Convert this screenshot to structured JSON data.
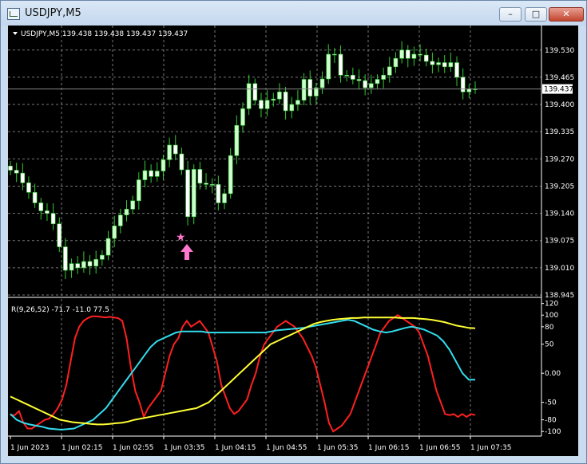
{
  "window": {
    "title": "USDJPY,M5",
    "minimize_glyph": "–",
    "maximize_glyph": "□",
    "close_glyph": "✕"
  },
  "chart": {
    "header": "USDJPY,M5  139.438 139.438 139.437 139.437",
    "current_price": "139.437",
    "price_axis_labels": [
      "139.530",
      "139.465",
      "139.400",
      "139.335",
      "139.270",
      "139.205",
      "139.140",
      "139.075",
      "139.010",
      "138.945"
    ],
    "time_axis_labels": [
      "1 Jun 2023",
      "1 Jun 02:15",
      "1 Jun 02:55",
      "1 Jun 03:35",
      "1 Jun 04:15",
      "1 Jun 04:55",
      "1 Jun 05:35",
      "1 Jun 06:15",
      "1 Jun 06:55",
      "1 Jun 07:35"
    ],
    "star_marker": "★",
    "arrow_marker": "up-arrow",
    "colors": {
      "background": "#000000",
      "bull": "#ccffcc",
      "bear": "#ffffff",
      "wick": "#33cc33",
      "grid": "#777777",
      "axis_text": "#ffffff",
      "marker": "#ff77cc"
    }
  },
  "indicator": {
    "label": "R(9,26,52) -71.7 -11.0 77.5",
    "axis_labels": [
      "120",
      "100",
      "80",
      "50",
      "0.00",
      "-50",
      "-80",
      "-100"
    ],
    "colors": {
      "fast": "#ff2020",
      "mid": "#33ddee",
      "slow": "#ffff33"
    }
  },
  "chart_data": [
    {
      "type": "candlestick",
      "title": "USDJPY,M5",
      "ylim": [
        138.945,
        139.56
      ],
      "x": [
        "1 Jun 2023",
        "1 Jun 02:15",
        "1 Jun 02:55",
        "1 Jun 03:35",
        "1 Jun 04:15",
        "1 Jun 04:55",
        "1 Jun 05:35",
        "1 Jun 06:15",
        "1 Jun 06:55",
        "1 Jun 07:35"
      ],
      "close": [
        139.243,
        139.236,
        139.213,
        139.19,
        139.165,
        139.146,
        139.14,
        139.115,
        139.06,
        139.004,
        139.02,
        139.01,
        139.025,
        139.014,
        139.03,
        139.04,
        139.08,
        139.11,
        139.136,
        139.15,
        139.17,
        139.22,
        139.242,
        139.228,
        139.241,
        139.268,
        139.303,
        139.282,
        139.244,
        139.132,
        139.245,
        139.212,
        139.209,
        139.209,
        139.165,
        139.187,
        139.278,
        139.35,
        139.39,
        139.45,
        139.41,
        139.39,
        139.41,
        139.413,
        139.43,
        139.385,
        139.4,
        139.41,
        139.46,
        139.42,
        139.44,
        139.461,
        139.52,
        139.52,
        139.47,
        139.47,
        139.46,
        139.457,
        139.44,
        139.45,
        139.46,
        139.47,
        139.49,
        139.51,
        139.53,
        139.51,
        139.52,
        139.518,
        139.503,
        139.495,
        139.5,
        139.49,
        139.5,
        139.465,
        139.43,
        139.437,
        139.437
      ]
    },
    {
      "type": "line",
      "title": "R(9,26,52) -71.7 -11.0 77.5",
      "ylim": [
        -108,
        125
      ],
      "series": [
        {
          "name": "R(9)",
          "values": [
            -72,
            -72,
            -65,
            -85,
            -95,
            -95,
            -90,
            -85,
            -80,
            -78,
            -70,
            -60,
            -45,
            -20,
            20,
            60,
            80,
            90,
            95,
            98,
            98,
            97,
            96,
            97,
            96,
            95,
            90,
            60,
            10,
            -30,
            -50,
            -75,
            -60,
            -50,
            -40,
            -30,
            0,
            30,
            50,
            60,
            80,
            90,
            80,
            85,
            90,
            80,
            70,
            45,
            20,
            -20,
            -40,
            -60,
            -70,
            -65,
            -55,
            -45,
            -20,
            0,
            30,
            50,
            60,
            70,
            80,
            85,
            90,
            85,
            80,
            70,
            60,
            45,
            30,
            10,
            -20,
            -50,
            -85,
            -100,
            -95,
            -90,
            -80,
            -70,
            -50,
            -30,
            -10,
            10,
            30,
            50,
            70,
            80,
            90,
            95,
            100,
            95,
            90,
            85,
            80,
            70,
            50,
            30,
            0,
            -30,
            -50,
            -70,
            -72,
            -70,
            -75,
            -70,
            -75,
            -70,
            -72
          ]
        },
        {
          "name": "R(26)",
          "values": [
            -70,
            -80,
            -85,
            -88,
            -90,
            -92,
            -95,
            -96,
            -97,
            -96,
            -95,
            -90,
            -85,
            -80,
            -70,
            -60,
            -45,
            -30,
            -15,
            0,
            15,
            30,
            45,
            55,
            60,
            65,
            70,
            72,
            72,
            72,
            72,
            70,
            70,
            70,
            70,
            70,
            70,
            70,
            70,
            70,
            70,
            72,
            74,
            75,
            76,
            77,
            78,
            80,
            82,
            84,
            86,
            88,
            90,
            92,
            90,
            85,
            80,
            75,
            72,
            70,
            72,
            75,
            78,
            80,
            78,
            75,
            70,
            65,
            55,
            40,
            20,
            0,
            -11,
            -11
          ]
        },
        {
          "name": "R(52)",
          "values": [
            -40,
            -45,
            -50,
            -55,
            -60,
            -65,
            -70,
            -75,
            -80,
            -82,
            -84,
            -85,
            -86,
            -87,
            -88,
            -88,
            -87,
            -86,
            -85,
            -83,
            -80,
            -78,
            -76,
            -74,
            -72,
            -70,
            -68,
            -66,
            -64,
            -62,
            -60,
            -55,
            -50,
            -40,
            -30,
            -20,
            -10,
            0,
            10,
            20,
            30,
            40,
            50,
            55,
            60,
            65,
            70,
            75,
            80,
            85,
            88,
            90,
            92,
            93,
            94,
            95,
            95,
            96,
            96,
            96,
            96,
            96,
            96,
            95,
            95,
            95,
            94,
            93,
            92,
            90,
            88,
            85,
            82,
            80,
            78,
            77.5
          ]
        }
      ]
    }
  ]
}
